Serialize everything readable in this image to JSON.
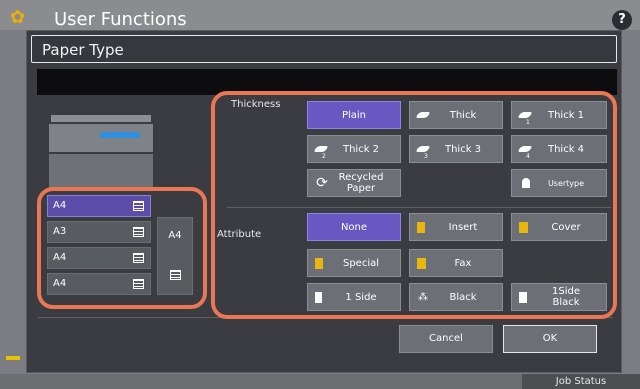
{
  "app": {
    "title": "User Functions",
    "help_label": "?"
  },
  "dialog": {
    "title": "Paper Type"
  },
  "drawers": [
    {
      "size": "A4",
      "selected": true
    },
    {
      "size": "A3",
      "selected": false
    },
    {
      "size": "A4",
      "selected": false
    },
    {
      "size": "A4",
      "selected": false
    }
  ],
  "bypass": {
    "size": "A4"
  },
  "thickness": {
    "label": "Thickness",
    "options": [
      {
        "label": "Plain",
        "selected": true
      },
      {
        "label": "Thick",
        "sub": ""
      },
      {
        "label": "Thick 1",
        "sub": "1"
      },
      {
        "label": "Thick 2",
        "sub": "2"
      },
      {
        "label": "Thick 3",
        "sub": "3"
      },
      {
        "label": "Thick 4",
        "sub": "4"
      },
      {
        "label": "Recycled\nPaper"
      },
      {
        "label": "Usertype"
      }
    ]
  },
  "attribute": {
    "label": "Attribute",
    "options": [
      {
        "label": "None",
        "selected": true
      },
      {
        "label": "Insert"
      },
      {
        "label": "Cover"
      },
      {
        "label": "Special"
      },
      {
        "label": "Fax"
      },
      {
        "label": "1 Side"
      },
      {
        "label": "Black"
      },
      {
        "label": "1Side\nBlack"
      }
    ]
  },
  "actions": {
    "cancel": "Cancel",
    "ok": "OK"
  },
  "footer": {
    "job_status": "Job Status"
  },
  "colors": {
    "selected": "#6a58c2",
    "highlight": "#ea7654",
    "icon_yellow": "#e8b70e"
  }
}
